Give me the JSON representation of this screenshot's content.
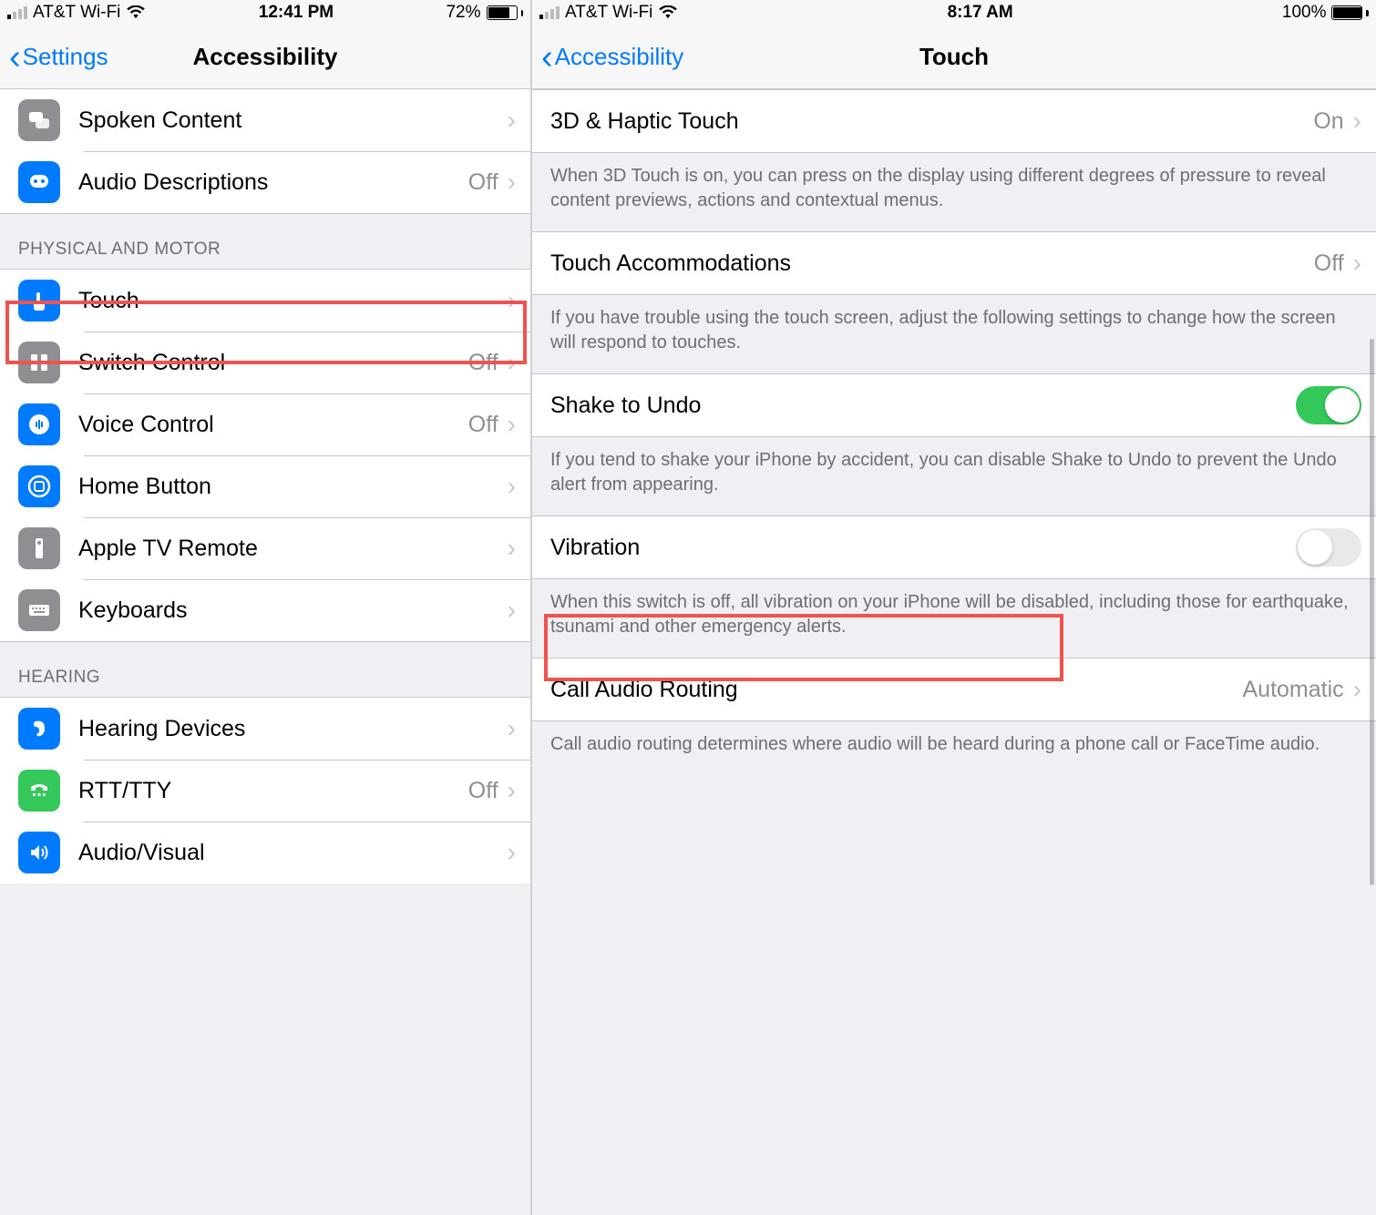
{
  "left": {
    "statusbar": {
      "carrier": "AT&T Wi-Fi",
      "time": "12:41 PM",
      "battery_pct": "72%",
      "battery_fill": 72
    },
    "nav": {
      "back": "Settings",
      "title": "Accessibility"
    },
    "group_top": [
      {
        "label": "Spoken Content",
        "value": "",
        "icon": "speech-bubbles-icon",
        "icon_bg": "icon-gray"
      },
      {
        "label": "Audio Descriptions",
        "value": "Off",
        "icon": "caption-bubble-icon",
        "icon_bg": "icon-blue"
      }
    ],
    "header_physical": "PHYSICAL AND MOTOR",
    "group_physical": [
      {
        "label": "Touch",
        "value": "",
        "icon": "hand-tap-icon",
        "icon_bg": "icon-blue"
      },
      {
        "label": "Switch Control",
        "value": "Off",
        "icon": "switch-grid-icon",
        "icon_bg": "icon-gray"
      },
      {
        "label": "Voice Control",
        "value": "Off",
        "icon": "voice-bubble-icon",
        "icon_bg": "icon-blue"
      },
      {
        "label": "Home Button",
        "value": "",
        "icon": "home-button-icon",
        "icon_bg": "icon-blue"
      },
      {
        "label": "Apple TV Remote",
        "value": "",
        "icon": "remote-icon",
        "icon_bg": "icon-gray"
      },
      {
        "label": "Keyboards",
        "value": "",
        "icon": "keyboard-icon",
        "icon_bg": "icon-gray"
      }
    ],
    "header_hearing": "HEARING",
    "group_hearing": [
      {
        "label": "Hearing Devices",
        "value": "",
        "icon": "ear-icon",
        "icon_bg": "icon-blue"
      },
      {
        "label": "RTT/TTY",
        "value": "Off",
        "icon": "tty-icon",
        "icon_bg": "icon-green"
      },
      {
        "label": "Audio/Visual",
        "value": "",
        "icon": "speaker-icon",
        "icon_bg": "icon-blue"
      }
    ]
  },
  "right": {
    "statusbar": {
      "carrier": "AT&T Wi-Fi",
      "time": "8:17 AM",
      "battery_pct": "100%",
      "battery_fill": 100
    },
    "nav": {
      "back": "Accessibility",
      "title": "Touch"
    },
    "row_3d": {
      "label": "3D & Haptic Touch",
      "value": "On"
    },
    "footer_3d": "When 3D Touch is on, you can press on the display using different degrees of pressure to reveal content previews, actions and contextual menus.",
    "row_accom": {
      "label": "Touch Accommodations",
      "value": "Off"
    },
    "footer_accom": "If you have trouble using the touch screen, adjust the following settings to change how the screen will respond to touches.",
    "row_shake": {
      "label": "Shake to Undo",
      "toggle": true
    },
    "footer_shake": "If you tend to shake your iPhone by accident, you can disable Shake to Undo to prevent the Undo alert from appearing.",
    "row_vib": {
      "label": "Vibration",
      "toggle": false
    },
    "footer_vib": "When this switch is off, all vibration on your iPhone will be disabled, including those for earthquake, tsunami and other emergency alerts.",
    "row_call": {
      "label": "Call Audio Routing",
      "value": "Automatic"
    },
    "footer_call": "Call audio routing determines where audio will be heard during a phone call or FaceTime audio."
  }
}
